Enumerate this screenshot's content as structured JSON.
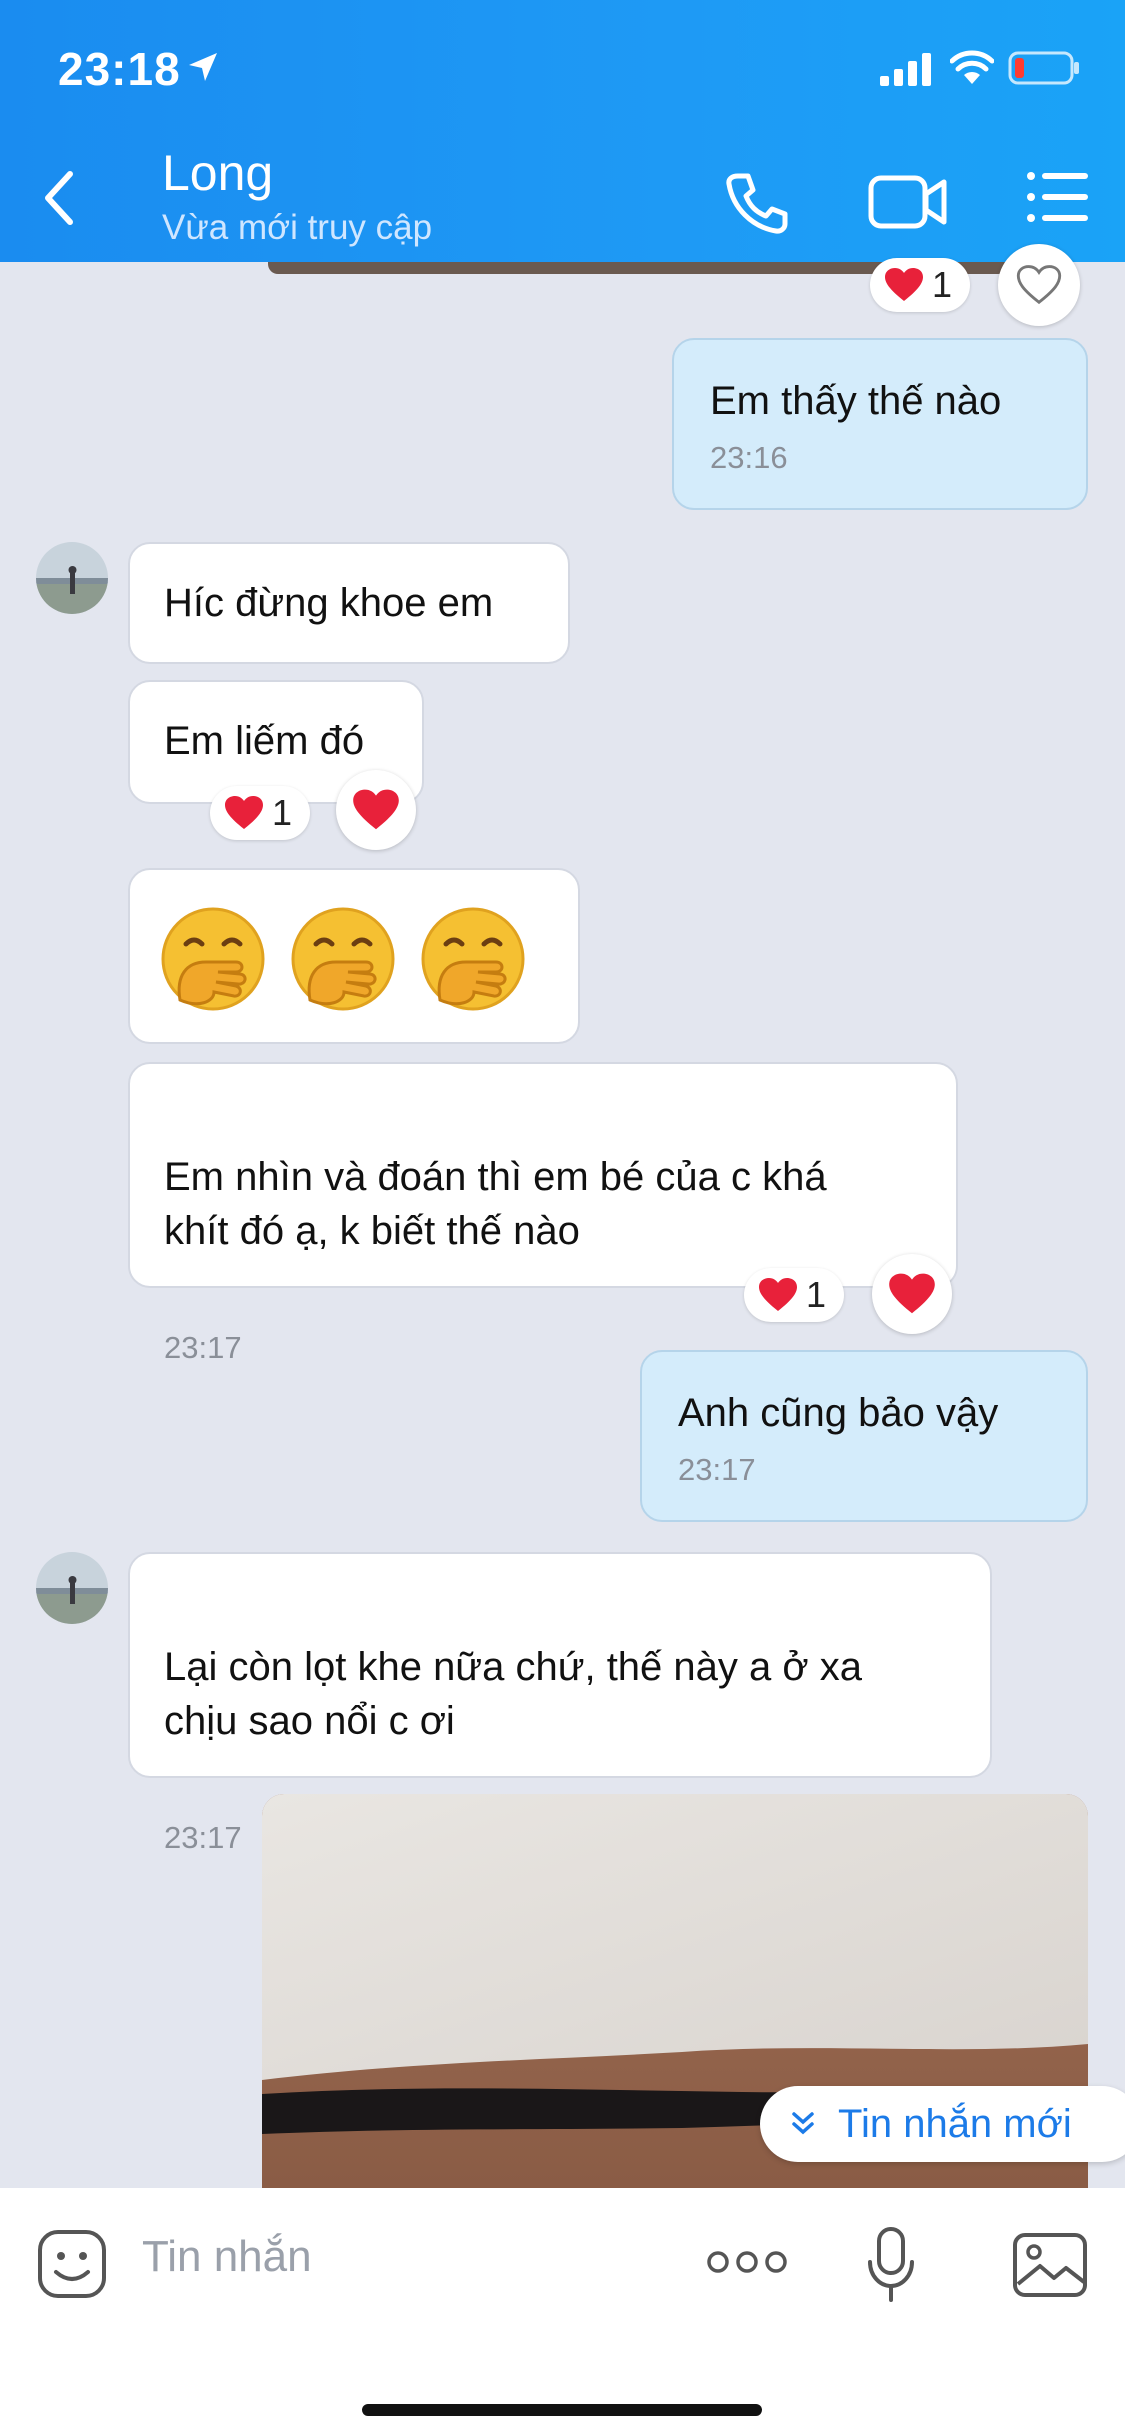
{
  "status_bar": {
    "time": "23:18"
  },
  "header": {
    "contact_name": "Long",
    "presence": "Vừa mới truy cập"
  },
  "messages": [
    {
      "text": "Em thấy thế nào",
      "time": "23:16"
    },
    {
      "text": "Híc đừng khoe em"
    },
    {
      "text": "Em liếm đó",
      "reaction_count": "1"
    },
    {
      "text": "Em nhìn và đoán thì em bé của c khá\nkhít đó ạ, k biết thế nào",
      "time": "23:17",
      "reaction_count": "1"
    },
    {
      "text": "Anh cũng bảo vậy",
      "time": "23:17"
    },
    {
      "text": "Lại còn lọt khe nữa chứ, thế này a ở xa\nchịu sao nổi c ơi",
      "time": "23:17"
    }
  ],
  "top_reaction_count": "1",
  "new_messages_label": "Tin nhắn mới",
  "composer": {
    "placeholder": "Tin nhắn"
  },
  "colors": {
    "header": "#1a8cf0",
    "outgoing_bubble": "#d4ecfb",
    "incoming_bubble": "#ffffff",
    "heart": "#e8213a",
    "accent": "#1c7be8"
  },
  "icons": [
    "location-arrow-icon",
    "signal-icon",
    "wifi-icon",
    "battery-icon",
    "back-chevron-icon",
    "phone-icon",
    "video-camera-icon",
    "menu-list-icon",
    "heart-icon",
    "emoji-face-icon",
    "more-dots-icon",
    "microphone-icon",
    "image-icon",
    "double-chevron-down-icon"
  ]
}
